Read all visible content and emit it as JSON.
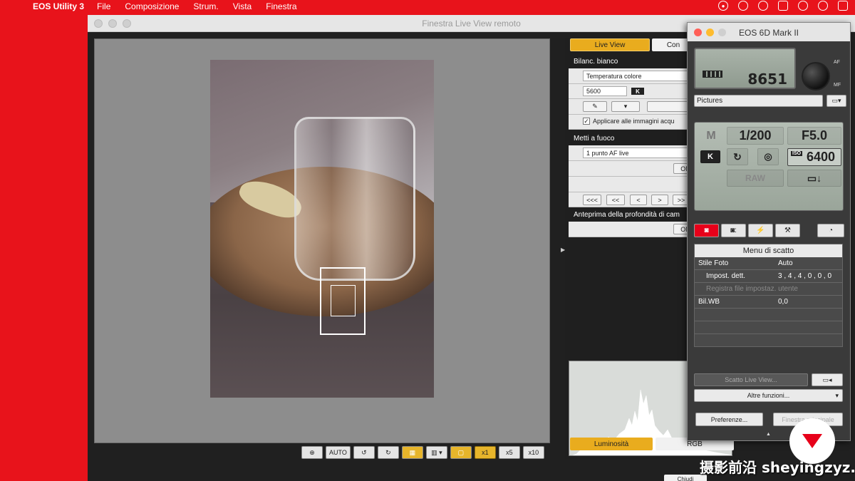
{
  "menubar": {
    "app_name": "EOS Utility 3",
    "items": [
      "File",
      "Composizione",
      "Strum.",
      "Vista",
      "Finestra"
    ]
  },
  "liveview": {
    "title": "Finestra Live View remoto",
    "tab_live_view": "Live View",
    "tab_other": "Con",
    "white_balance": {
      "heading": "Bilanc. bianco",
      "mode": "Temperatura colore",
      "kelvin_value": "5600",
      "kelvin_badge": "K",
      "apply_label": "Applicare alle immagini acqu"
    },
    "focus": {
      "heading": "Metti a fuoco",
      "af_mode": "1 punto AF live",
      "on_label": "ON",
      "nav_buttons": [
        "<<<",
        "<<",
        "<",
        ">",
        ">>"
      ]
    },
    "dof": {
      "heading": "Anteprima della profondità di cam",
      "on_label": "ON"
    },
    "toolbar": [
      "AUTO",
      "x1",
      "x5",
      "x10"
    ],
    "bottom_tabs": {
      "luminosity": "Luminosità",
      "rgb": "RGB"
    },
    "close_label": "Chiudi"
  },
  "eos": {
    "title": "EOS 6D Mark II",
    "shots_remaining": "8651",
    "af_label": "AF",
    "mf_label": "MF",
    "folder": "Pictures",
    "mode": "M",
    "shutter": "1/200",
    "aperture": "F5.0",
    "wb_badge": "K",
    "iso_label": "ISO",
    "iso": "6400",
    "raw": "RAW",
    "menu": {
      "header": "Menu di scatto",
      "rows": [
        {
          "key": "Stile Foto",
          "value": "Auto"
        },
        {
          "key": "Impost. dett.",
          "value": "3 , 4 , 4 , 0 , 0 , 0"
        },
        {
          "key": "Registra file impostaz. utente",
          "value": ""
        },
        {
          "key": "Bil.WB",
          "value": "0,0"
        }
      ]
    },
    "live_view_shoot": "Scatto Live View...",
    "more_functions": "Altre funzioni...",
    "preferences": "Preferenze...",
    "main_window": "Finestra principale"
  },
  "watermark": {
    "text": "摄影前沿 sheyingzyz.com"
  },
  "colors": {
    "accent": "#e9ac1e",
    "brand_red": "#e7001a",
    "background_red": "#e8131b"
  }
}
